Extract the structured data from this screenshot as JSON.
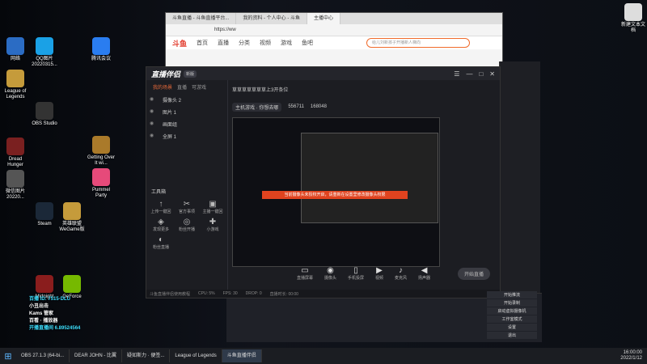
{
  "desktop_icons": [
    {
      "label": "网络",
      "name": "network-icon",
      "color": "#2b6cc4"
    },
    {
      "label": "QQ图片20220315...",
      "name": "qq-image-icon",
      "color": "#1aa1e6"
    },
    {
      "label": "League of Legends",
      "name": "league-icon",
      "color": "#c59b3b"
    },
    {
      "label": "OBS Studio",
      "name": "obs-icon",
      "color": "#333"
    },
    {
      "label": "Dread Hunger",
      "name": "dread-hunger-icon",
      "color": "#7a2020"
    },
    {
      "label": "微信图片20220...",
      "name": "wechat-image-icon",
      "color": "#555"
    },
    {
      "label": "Steam",
      "name": "steam-icon",
      "color": "#1b2838"
    },
    {
      "label": "Midnight",
      "name": "midnight-icon",
      "color": "#8a1d1d"
    },
    {
      "label": "GeForce",
      "name": "geforce-icon",
      "color": "#76b900"
    },
    {
      "label": "腾讯会议",
      "name": "tencent-meeting-icon",
      "color": "#2a7df0"
    },
    {
      "label": "Getting Over It wi...",
      "name": "getting-over-it-icon",
      "color": "#aa7a2a"
    },
    {
      "label": "Pummel Party",
      "name": "pummel-party-icon",
      "color": "#e64a7a"
    },
    {
      "label": "英雄联盟WeGame版",
      "name": "lol-wegame-icon",
      "color": "#c59b3b"
    },
    {
      "label": "新建文本文档",
      "name": "text-doc-icon",
      "color": "#ddd"
    }
  ],
  "browser": {
    "tabs": [
      "斗鱼直播 - 斗鱼直播平台...",
      "我的资料 - 个人中心 - 斗鱼",
      "主播中心"
    ],
    "url": "https://ww",
    "site_logo": "斗鱼",
    "nav": [
      "首页",
      "直播",
      "分类",
      "视频",
      "游戏",
      "鱼吧"
    ],
    "search_placeholder": "给儿刘新孩子开播新人梯向"
  },
  "app": {
    "logo": "直播伴侣",
    "tag": "新版",
    "left_tabs": [
      "我的场景",
      "直播",
      "可游戏"
    ],
    "scenes": [
      "摄像头 2",
      "图片 1",
      "画面组",
      "全屏 1"
    ],
    "tools_title": "工具箱",
    "tools": [
      {
        "label": "上传一键回",
        "icon": "↑"
      },
      {
        "label": "官方事项",
        "icon": "✂"
      },
      {
        "label": "主播一键回",
        "icon": "▣"
      },
      {
        "label": "发现更多",
        "icon": "◈"
      },
      {
        "label": "粉丝开播",
        "icon": "◎"
      },
      {
        "label": "小游戏",
        "icon": "✚"
      },
      {
        "label": "粉丝直播",
        "icon": "◐"
      }
    ],
    "room_title": "草草草草草草草上3开条位",
    "room_category": "主机游戏 · 你想去哪",
    "room_id": "556711",
    "fans": "168048",
    "banner_text": "当前摄像头未授权开启，请重新在设置里修改摄像头权限",
    "controls": [
      {
        "label": "直播屏幕",
        "icon": "▭"
      },
      {
        "label": "摄像头",
        "icon": "◉"
      },
      {
        "label": "手机投屏",
        "icon": "▯"
      },
      {
        "label": "视频",
        "icon": "▶"
      },
      {
        "label": "麦克风",
        "icon": "♪"
      },
      {
        "label": "扬声器",
        "icon": "◀"
      }
    ],
    "live_button": "开始直播",
    "status": [
      "斗鱼直播伴侣使用教程",
      "CPU: 5%",
      "FPS: 30",
      "DROP: 0",
      "直播时长: 00:00"
    ]
  },
  "overlay": {
    "lines": [
      "百播 ID: 7515·DLU",
      "小丑出击",
      "Kams 管家",
      "百看 · 播放器",
      "开播直播间 6.89524564"
    ]
  },
  "obs_menu": [
    "开始推流",
    "开始录制",
    "启动虚拟摄像机",
    "工作室模式",
    "设置",
    "退出"
  ],
  "taskbar": {
    "items": [
      "OBS 27.1.3 (64-bi...",
      "DEAR JOHN - 比翼",
      "疑如斯力 · 便签...",
      "League of Legends",
      "斗鱼直播伴侣"
    ],
    "time": "16:00:00",
    "date": "2022/1/12"
  }
}
